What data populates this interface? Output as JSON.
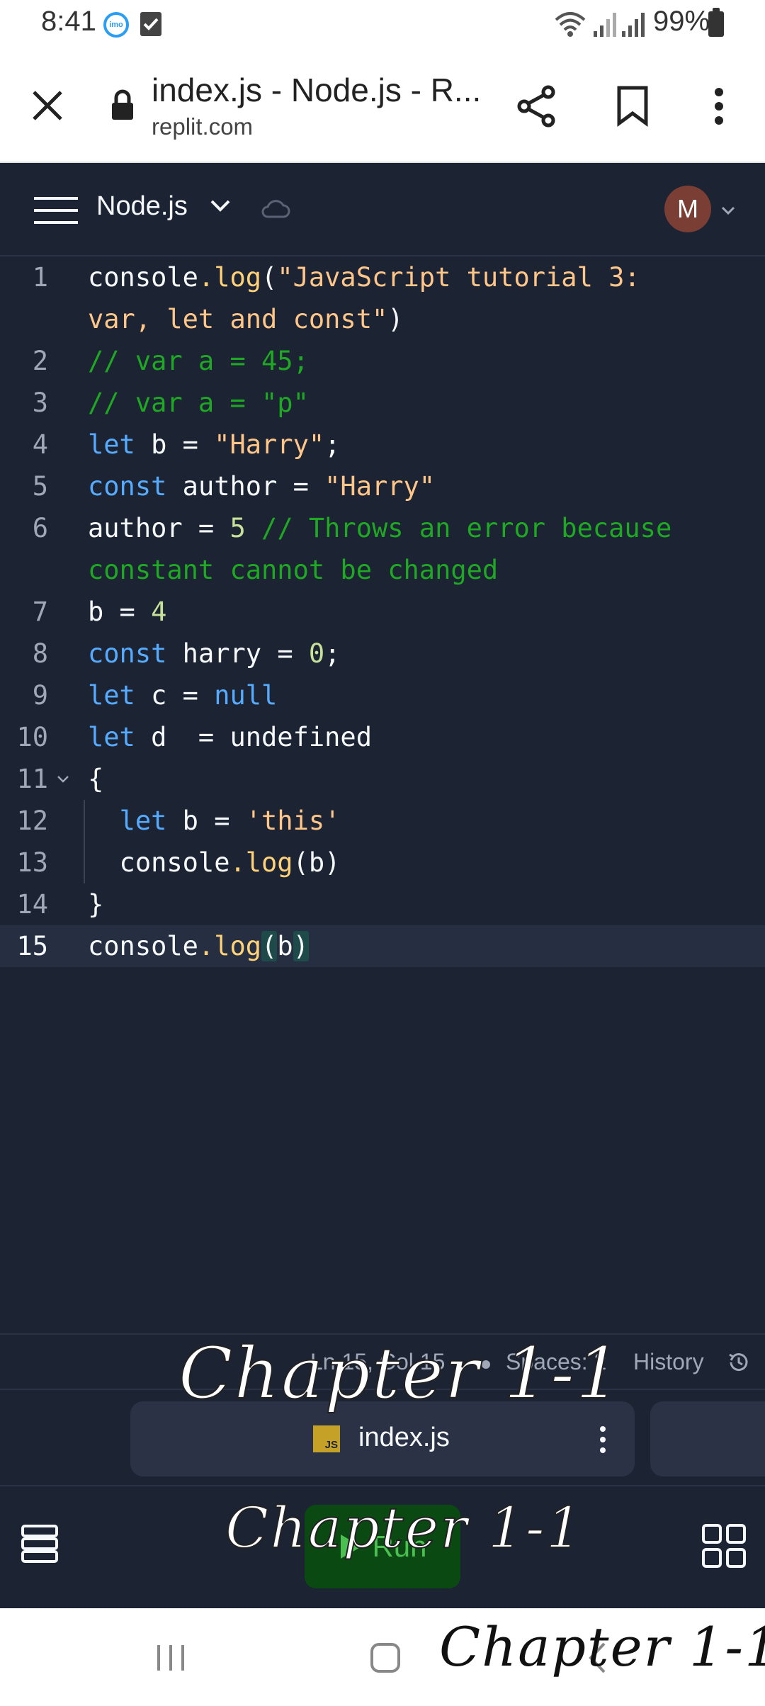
{
  "status_bar": {
    "time": "8:41",
    "imo_badge": "imo",
    "battery": "99%"
  },
  "browser": {
    "title": "index.js - Node.js - R...",
    "url": "replit.com"
  },
  "app_header": {
    "repl_name": "Node.js",
    "avatar_initial": "M"
  },
  "editor": {
    "language": "javascript",
    "active_line": 15,
    "lines": [
      {
        "n": "1",
        "text": "console.log(\"JavaScript tutorial 3:"
      },
      {
        "n": "",
        "text": "var, let and const\")"
      },
      {
        "n": "2",
        "text": "// var a = 45;"
      },
      {
        "n": "3",
        "text": "// var a = \"p\""
      },
      {
        "n": "4",
        "text": "let b = \"Harry\";"
      },
      {
        "n": "5",
        "text": "const author = \"Harry\""
      },
      {
        "n": "6",
        "text": "author = 5 // Throws an error because"
      },
      {
        "n": "",
        "text": "constant cannot be changed"
      },
      {
        "n": "7",
        "text": "b = 4"
      },
      {
        "n": "8",
        "text": "const harry = 0;"
      },
      {
        "n": "9",
        "text": "let c = null"
      },
      {
        "n": "10",
        "text": "let d  = undefined"
      },
      {
        "n": "11",
        "text": "{"
      },
      {
        "n": "12",
        "text": "  let b = 'this'"
      },
      {
        "n": "13",
        "text": "  console.log(b)"
      },
      {
        "n": "14",
        "text": "}"
      },
      {
        "n": "15",
        "text": "console.log(b)"
      }
    ]
  },
  "status_line": {
    "position": "Ln 15, Col 15",
    "spaces": "Spaces: 2",
    "history": "History"
  },
  "tabs": {
    "active_tab": "index.js",
    "js_badge": "JS"
  },
  "toolbar": {
    "run_label": "Run"
  },
  "watermark": {
    "text": "Chapter 1-1"
  },
  "colors": {
    "editor_bg": "#1c2333",
    "keyword": "#57abff",
    "string": "#ffc68a",
    "comment": "#1fa823",
    "number": "#c8e19a",
    "run_button": "#0a4a12"
  }
}
